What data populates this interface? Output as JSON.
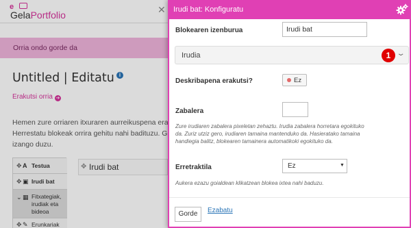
{
  "logo": {
    "prefix": "e",
    "name_part1": "Gela",
    "name_part2": "Portfolio"
  },
  "background": {
    "close_glyph": "✕",
    "message": "Orria ondo gorde da",
    "page_title": "Untitled | Editatu",
    "example_link": "Erakutsi orria",
    "intro_lines": [
      "Hemen zure orriaren itxuraren aurreikuspena erak",
      "Herrestatu blokeak orrira gehitu nahi badituzu. Ge",
      "izango duzu."
    ],
    "block_list": [
      {
        "label": "Testua",
        "icon": "text-icon",
        "glyph": "A"
      },
      {
        "label": "Irudi bat",
        "icon": "image-icon",
        "glyph": "▣"
      },
      {
        "label": "Fitxategiak, irudiak eta bideoa",
        "icon": "film-icon",
        "glyph": "▦"
      },
      {
        "label": "Erunkariak",
        "icon": "pencil-icon",
        "glyph": "✎"
      }
    ],
    "dropped_block_title": "Irudi bat"
  },
  "modal": {
    "title": "Irudi bat: Konfiguratu",
    "fields": {
      "title_label": "Blokearen izenburua",
      "title_value": "Irudi bat",
      "accordion_label": "Irudia",
      "callout_number": "1",
      "description_label": "Deskribapena erakutsi?",
      "description_toggle": "Ez",
      "width_label": "Zabalera",
      "width_value": "",
      "width_help": "Zure irudiaren zabalera pixeletan zehaztu. Irudia zabalera horretara egokituko da. Zuriz utziz gero, irudiaren tamaina mantenduko da. Hasieratako tamaina handiegia balitz, blokearen tamainera automatikoki egokituko da.",
      "retract_label": "Erretraktila",
      "retract_value": "Ez",
      "retract_help": "Aukera ezazu goialdean klikatzean blokea ixtea nahi baduzu."
    },
    "buttons": {
      "save": "Gorde",
      "remove": "Ezabatu"
    }
  },
  "colors": {
    "accent": "#e040b4",
    "message_bg": "#f0b5dd",
    "link_blue": "#2a75b7",
    "callout_red": "#e00000"
  }
}
